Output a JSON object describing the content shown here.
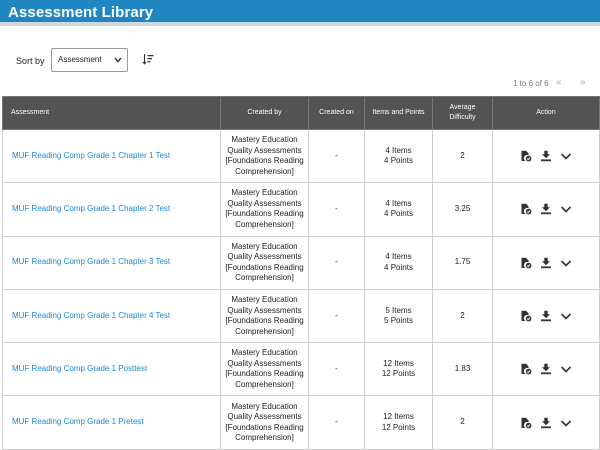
{
  "header": {
    "title": "Assessment Library"
  },
  "sort": {
    "label": "Sort by",
    "selected": "Assessment"
  },
  "pager": {
    "text": "1 to 6 of 6",
    "prev": "«",
    "next": "»"
  },
  "table": {
    "columns": [
      "Assessment",
      "Created by",
      "Created on",
      "Items and Points",
      "Average Difficulty",
      "Action"
    ],
    "rows": [
      {
        "name": "MUF Reading Comp Grade 1 Chapter 1 Test",
        "created_by": [
          "Mastery Education",
          "Quality Assessments",
          "[Foundations Reading",
          "Comprehension]"
        ],
        "created_on": "-",
        "items": "4 Items",
        "points": "4 Points",
        "difficulty": "2"
      },
      {
        "name": "MUF Reading Comp Grade 1 Chapter 2 Test",
        "created_by": [
          "Mastery Education",
          "Quality Assessments",
          "[Foundations Reading",
          "Comprehension]"
        ],
        "created_on": "-",
        "items": "4 Items",
        "points": "4 Points",
        "difficulty": "3.25"
      },
      {
        "name": "MUF Reading Comp Grade 1 Chapter 3 Test",
        "created_by": [
          "Mastery Education",
          "Quality Assessments",
          "[Foundations Reading",
          "Comprehension]"
        ],
        "created_on": "-",
        "items": "4 Items",
        "points": "4 Points",
        "difficulty": "1.75"
      },
      {
        "name": "MUF Reading Comp Grade 1 Chapter 4 Test",
        "created_by": [
          "Mastery Education",
          "Quality Assessments",
          "[Foundations Reading",
          "Comprehension]"
        ],
        "created_on": "-",
        "items": "5 Items",
        "points": "5 Points",
        "difficulty": "2"
      },
      {
        "name": "MUF Reading Comp Grade 1 Posttest",
        "created_by": [
          "Mastery Education",
          "Quality Assessments",
          "[Foundations Reading",
          "Comprehension]"
        ],
        "created_on": "-",
        "items": "12 Items",
        "points": "12 Points",
        "difficulty": "1.83"
      },
      {
        "name": "MUF Reading Comp Grade 1 Pretest",
        "created_by": [
          "Mastery Education",
          "Quality Assessments",
          "[Foundations Reading",
          "Comprehension]"
        ],
        "created_on": "-",
        "items": "12 Items",
        "points": "12 Points",
        "difficulty": "2"
      }
    ]
  },
  "icons": {
    "view": "document-check-icon",
    "download": "download-icon",
    "more": "chevron-down-icon",
    "sort_order": "sort-order-icon"
  },
  "colors": {
    "header": "#1f86c1",
    "link": "#1a8ad4",
    "table_header": "#535353"
  }
}
